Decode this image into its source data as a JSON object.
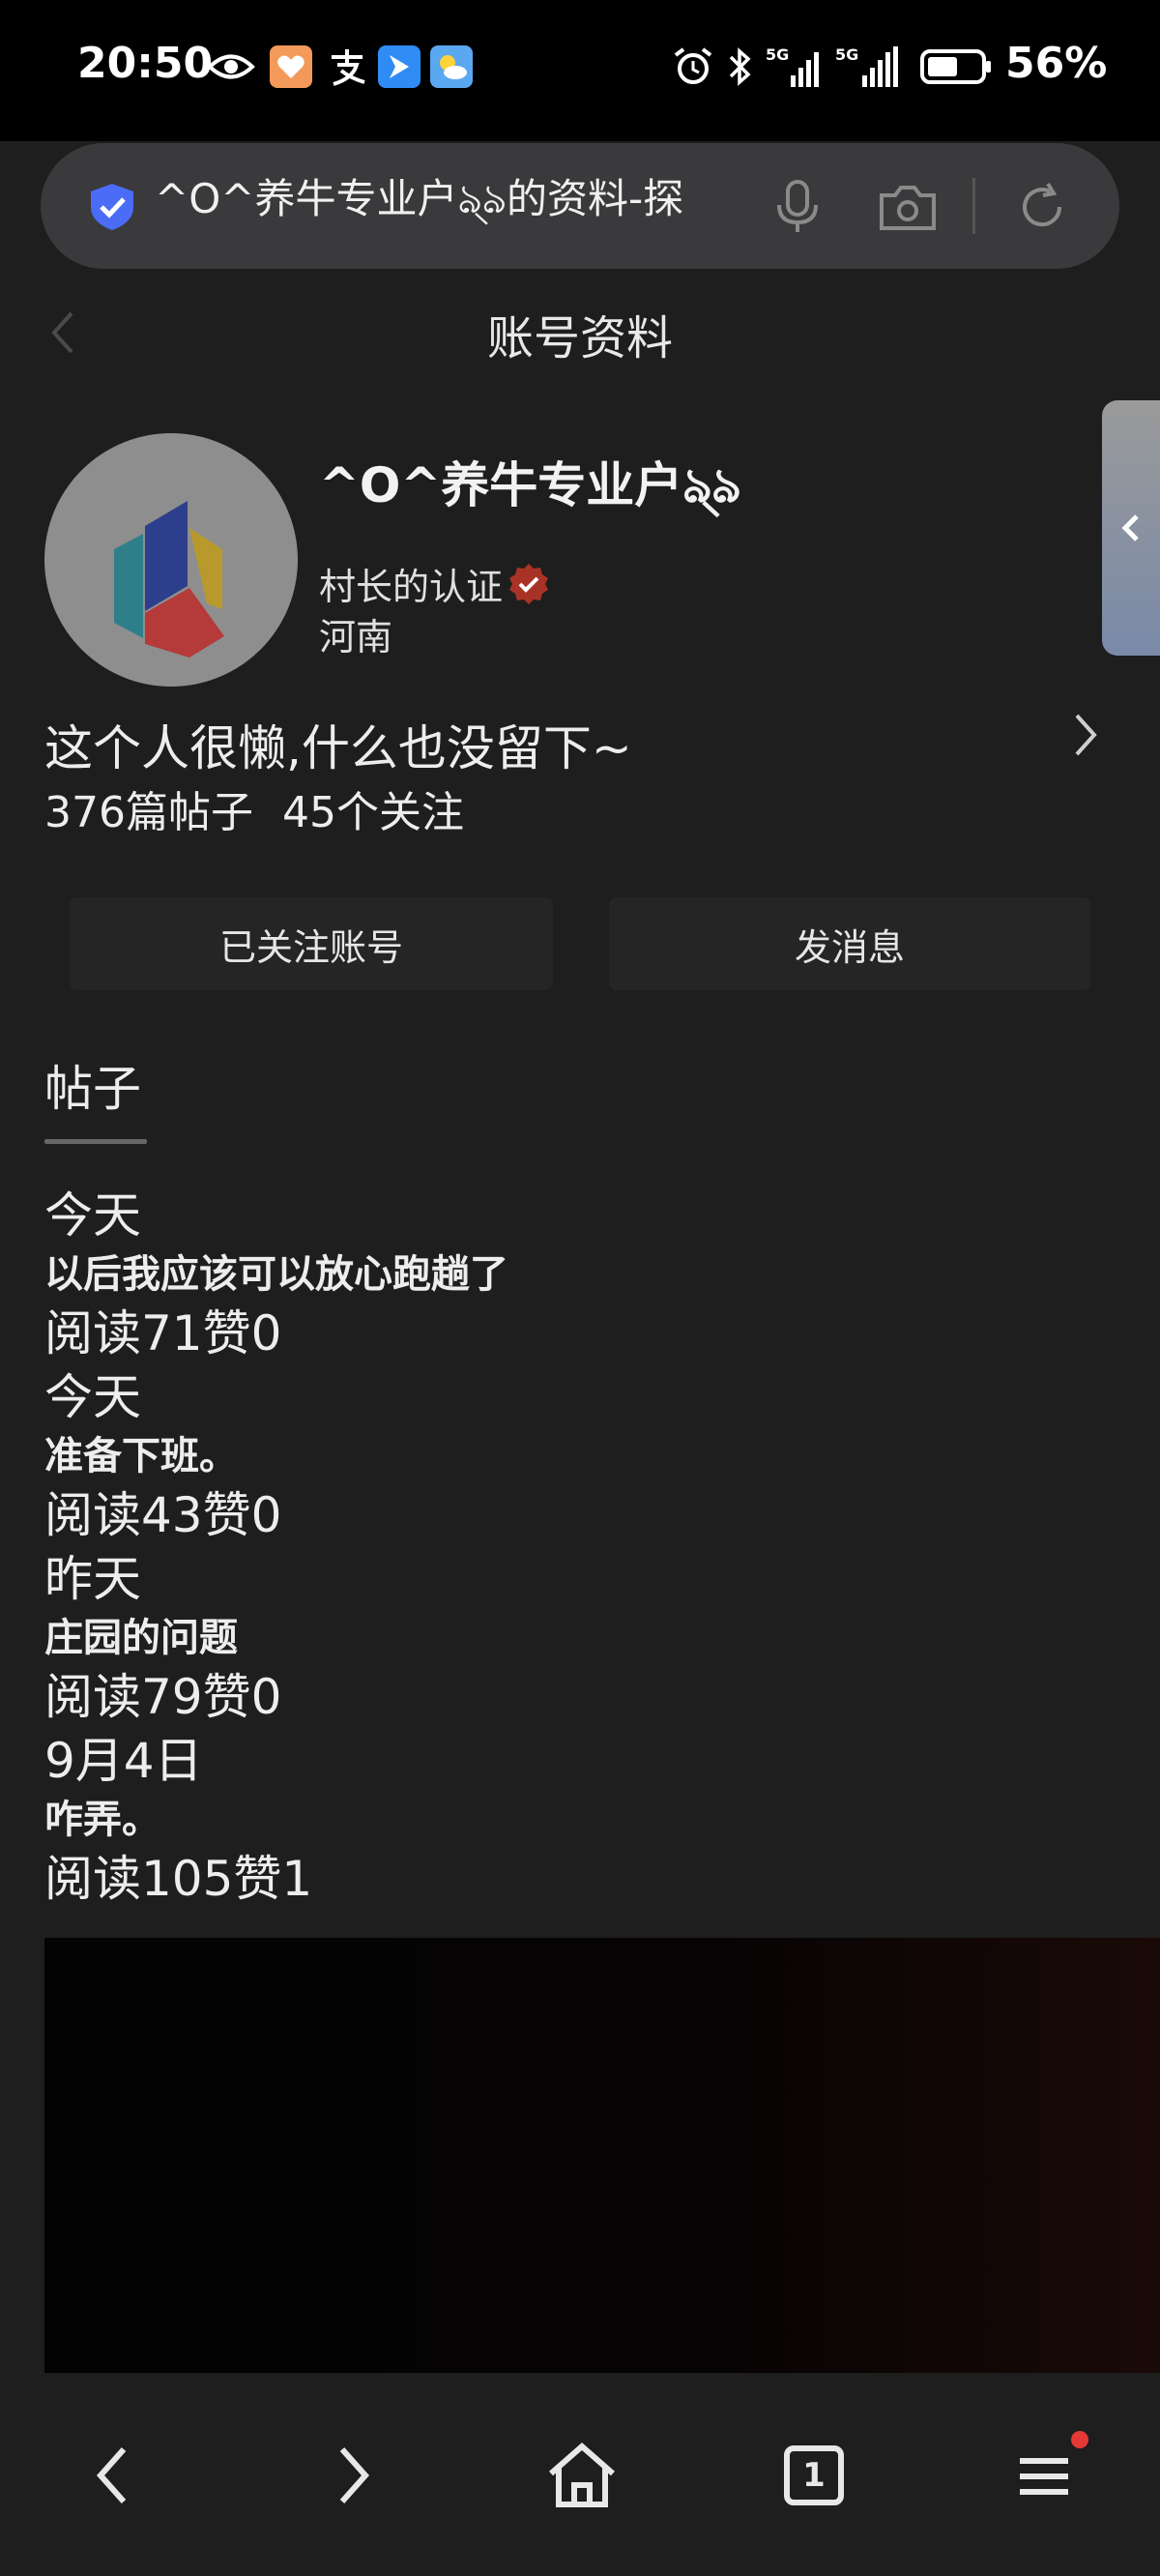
{
  "status_bar": {
    "time": "20:50",
    "battery_percent": "56%",
    "network_1": "5G",
    "network_2": "5G"
  },
  "address_bar": {
    "url_text": "^O^养牛专业户ঌ্ঌ的资料-探"
  },
  "page": {
    "title": "账号资料"
  },
  "profile": {
    "username": "^O^养牛专业户ঌ্ঌ",
    "verification_label": "村长的认证",
    "region": "河南",
    "bio": "这个人很懒,什么也没留下~",
    "posts_count": "376篇帖子",
    "following_count": "45个关注"
  },
  "actions": {
    "follow_button": "已关注账号",
    "message_button": "发消息"
  },
  "tabs": {
    "posts": "帖子"
  },
  "posts": [
    {
      "date": "今天",
      "title": "以后我应该可以放心跑趟了",
      "stats": "阅读71赞0"
    },
    {
      "date": "今天",
      "title": "准备下班。",
      "stats": "阅读43赞0"
    },
    {
      "date": "昨天",
      "title": "庄园的问题",
      "stats": "阅读79赞0"
    },
    {
      "date": "9月4日",
      "title": "咋弄。",
      "stats": "阅读105赞1"
    }
  ],
  "bottom_nav": {
    "tab_count": "1"
  },
  "colors": {
    "background": "#1e1e1e",
    "status_bar": "#000000",
    "url_bar": "#3a3a3c",
    "shield_accent": "#4a6cf7",
    "verify_badge": "#c0392b",
    "notification_dot": "#e53935"
  },
  "icons": [
    "eye-icon",
    "health-app-icon",
    "alipay-icon",
    "messenger-icon",
    "weather-icon",
    "alarm-icon",
    "bluetooth-icon",
    "signal-icon",
    "battery-icon",
    "shield-icon",
    "microphone-icon",
    "camera-icon",
    "refresh-icon",
    "back-icon",
    "side-panel-chevron-icon",
    "chevron-right-icon",
    "verified-badge-icon",
    "nav-back-icon",
    "nav-forward-icon",
    "home-icon",
    "tabs-icon",
    "menu-icon"
  ]
}
